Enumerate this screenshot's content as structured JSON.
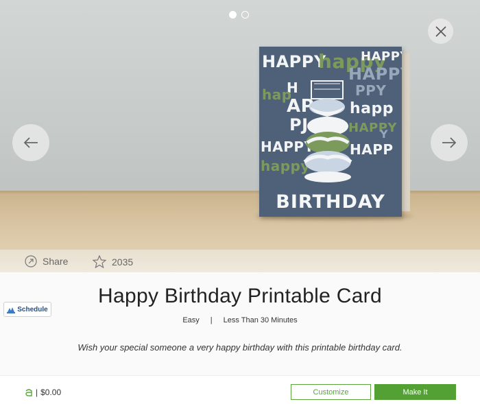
{
  "carousel": {
    "pages": 2,
    "active_page": 1
  },
  "card_art": {
    "words_top": [
      "HAPPY",
      "happy",
      "HAPPY"
    ],
    "word_right": "HAPPY",
    "word_mid_left": "HAPPY",
    "word_bday": "BIRTHDAY",
    "colors": {
      "card": "#4f6178",
      "green": "#7d9a5d",
      "white": "#f2f4f5"
    }
  },
  "actions": {
    "share_label": "Share",
    "favorites_count": "2035"
  },
  "project": {
    "schedule_label": "Schedule",
    "title": "Happy Birthday Printable Card",
    "difficulty": "Easy",
    "separator": "|",
    "duration": "Less Than 30 Minutes",
    "description": "Wish your special someone a very happy birthday with this printable birthday card."
  },
  "footer": {
    "price": "$0.00",
    "price_separator": "|",
    "customize_label": "Customize",
    "make_it_label": "Make It",
    "accent_color": "#53a135"
  },
  "icons": [
    "close-icon",
    "arrow-left-icon",
    "arrow-right-icon",
    "share-icon",
    "star-icon",
    "schedule-icon",
    "access-icon"
  ]
}
